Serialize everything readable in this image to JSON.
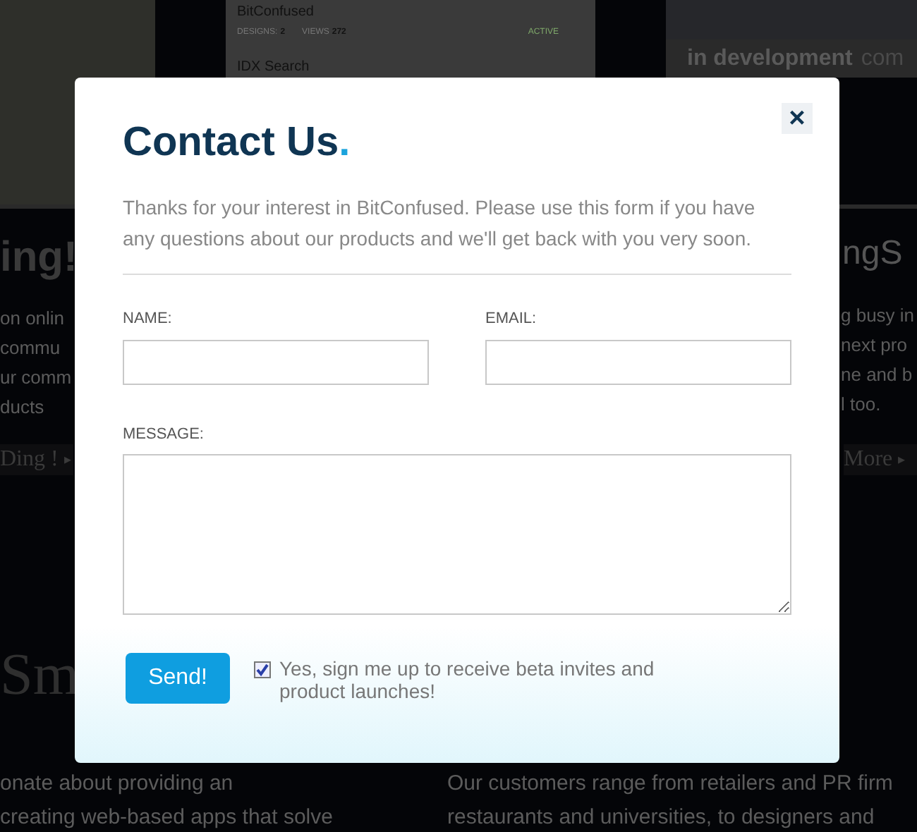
{
  "background": {
    "card": {
      "title": "BitConfused",
      "designs_label": "DESIGNS:",
      "designs": "2",
      "views_label": "VIEWS",
      "views": "272",
      "status": "ACTIVE",
      "next_title": "IDX Search"
    },
    "banner": {
      "bold": "in development",
      "rest": "com"
    },
    "left": {
      "heading": "ing!",
      "lines": [
        "on onlin",
        "commu",
        "ur comm",
        "ducts"
      ],
      "link": "Ding !",
      "link_arrow": "▸"
    },
    "right": {
      "heading": "ngS",
      "lines": [
        "g busy in",
        "next pro",
        "ne and b",
        "l too."
      ],
      "link": "More",
      "link_arrow": "▸"
    },
    "section_heading": "Sm",
    "bottom_left": [
      "onate about providing an",
      "creating web-based apps that solve"
    ],
    "bottom_right": [
      "Our customers range from retailers and PR firm",
      "restaurants and universities, to designers and"
    ]
  },
  "dialog": {
    "title": "Contact Us",
    "title_dot": ".",
    "close": "×",
    "intro": "Thanks for your interest in BitConfused. Please use this form if you have any questions about our products and we'll get back with you very soon.",
    "fields": [
      {
        "label": "NAME:",
        "kind": "text"
      },
      {
        "label": "EMAIL:",
        "kind": "text"
      },
      {
        "label": "MESSAGE:",
        "kind": "textarea"
      }
    ],
    "submit": "Send!",
    "opt_in": {
      "label": "Yes, sign me up to receive beta invites and product launches!",
      "checked": true
    }
  }
}
